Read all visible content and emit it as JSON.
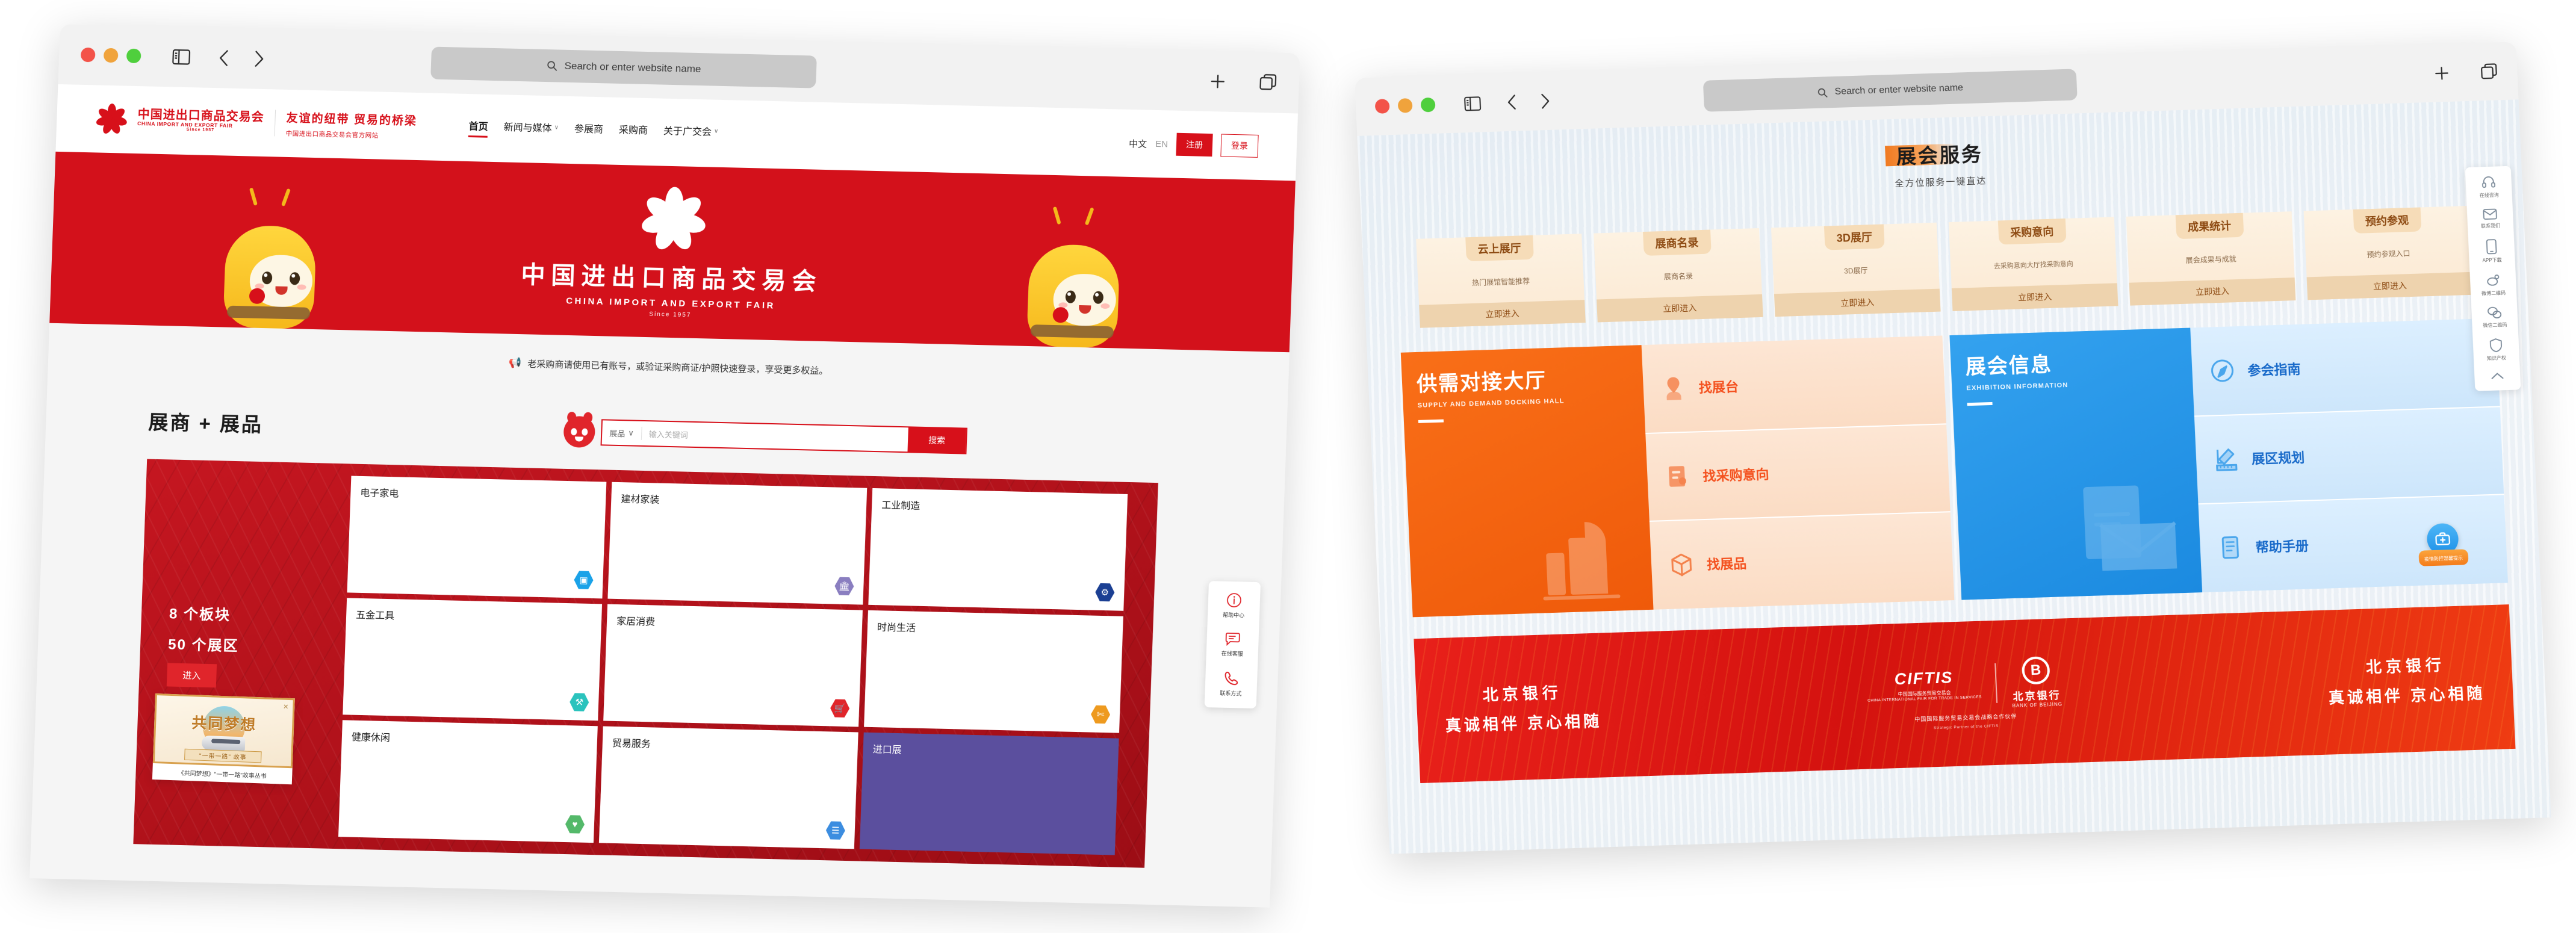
{
  "browser": {
    "search_placeholder": "Search or enter website name",
    "icons": {
      "sidebar": "sidebar-icon",
      "back": "back-chevron-icon",
      "forward": "forward-chevron-icon",
      "new_tab": "plus-icon",
      "tabs": "tab-overview-icon",
      "search": "search-icon"
    },
    "traffic_lights": [
      "close",
      "minimize",
      "zoom"
    ]
  },
  "left_window": {
    "nav": {
      "logo_cn": "中国进出口商品交易会",
      "logo_en": "CHINA IMPORT AND EXPORT FAIR",
      "logo_since": "Since 1957",
      "slogan_main": "友谊的纽带 贸易的桥梁",
      "slogan_sub": "中国进出口商品交易会官方网站",
      "menu": [
        {
          "label": "首页",
          "has_caret": false,
          "active": true
        },
        {
          "label": "新闻与媒体",
          "has_caret": true,
          "active": false
        },
        {
          "label": "参展商",
          "has_caret": false,
          "active": false
        },
        {
          "label": "采购商",
          "has_caret": false,
          "active": false
        },
        {
          "label": "关于广交会",
          "has_caret": true,
          "active": false
        }
      ],
      "lang_cn": "中文",
      "lang_en": "EN",
      "register": "注册",
      "login": "登录"
    },
    "hero": {
      "title_cn": "中国进出口商品交易会",
      "title_en": "CHINA IMPORT AND EXPORT FAIR",
      "since": "Since 1957",
      "bg_color": "#d3111b"
    },
    "notice": "老采购商请使用已有账号，或验证采购商证/护照快速登录，享受更多权益。",
    "section": {
      "title": "展商 + 展品",
      "search_select": "展品",
      "search_placeholder": "输入关键词",
      "search_button": "搜索"
    },
    "panel": {
      "line1": "8 个板块",
      "line2": "50 个展区",
      "enter_button": "进入"
    },
    "categories": [
      {
        "label": "电子家电",
        "icon": "chip-icon",
        "color": "#1aa2e8"
      },
      {
        "label": "建材家装",
        "icon": "building-icon",
        "color": "#8a7ec0"
      },
      {
        "label": "工业制造",
        "icon": "gear-icon",
        "color": "#1b3f93"
      },
      {
        "label": "五金工具",
        "icon": "tools-icon",
        "color": "#2bc3bd"
      },
      {
        "label": "家居消费",
        "icon": "cart-icon",
        "color": "#e0252b"
      },
      {
        "label": "时尚生活",
        "icon": "fashion-icon",
        "color": "#ee9a1f"
      },
      {
        "label": "健康休闲",
        "icon": "health-icon",
        "color": "#54b96a"
      },
      {
        "label": "贸易服务",
        "icon": "service-icon",
        "color": "#3c8de0"
      },
      {
        "label": "进口展",
        "icon": "import-icon",
        "color": "#5b4f9e"
      }
    ],
    "side_tools": [
      {
        "label": "帮助中心",
        "icon": "info-circle-icon"
      },
      {
        "label": "在线客服",
        "icon": "chat-bubble-icon"
      },
      {
        "label": "联系方式",
        "icon": "phone-icon"
      }
    ],
    "ad": {
      "title": "共同梦想",
      "scroll_text": "\"一带一路\" 故事",
      "caption": "《共同梦想》\"一带一路\"故事丛书",
      "close": "✕"
    }
  },
  "right_window": {
    "header": {
      "title": "展会服务",
      "subtitle": "全方位服务一键直达"
    },
    "service_cards": [
      {
        "title": "云上展厅",
        "desc": "热门展馆智能推荐",
        "button": "立即进入"
      },
      {
        "title": "展商名录",
        "desc": "展商名录",
        "button": "立即进入"
      },
      {
        "title": "3D展厅",
        "desc": "3D展厅",
        "button": "立即进入"
      },
      {
        "title": "采购意向",
        "desc": "去采购意向大厅找采购意向",
        "button": "立即进入"
      },
      {
        "title": "成果统计",
        "desc": "展会成果与成就",
        "button": "立即进入"
      },
      {
        "title": "预约参观",
        "desc": "预约参观入口",
        "button": "立即进入"
      }
    ],
    "blocks": [
      {
        "title_cn": "供需对接大厅",
        "title_en": "SUPPLY AND DEMAND DOCKING HALL",
        "theme": "orange",
        "color": "#f4511f",
        "links": [
          {
            "label": "找展台",
            "icon": "location-pin-person-icon"
          },
          {
            "label": "找采购意向",
            "icon": "document-person-icon"
          },
          {
            "label": "找展品",
            "icon": "package-box-icon"
          }
        ]
      },
      {
        "title_cn": "展会信息",
        "title_en": "EXHIBITION INFORMATION",
        "theme": "blue",
        "color": "#1769c9",
        "links": [
          {
            "label": "参会指南",
            "icon": "compass-icon"
          },
          {
            "label": "展区规划",
            "icon": "ruler-pencil-icon"
          },
          {
            "label": "帮助手册",
            "icon": "manual-book-icon"
          }
        ]
      }
    ],
    "bank_banner": {
      "left_line1": "北京银行",
      "left_line2": "真诚相伴 京心相随",
      "right_line1": "北京银行",
      "right_line2": "真诚相伴 京心相随",
      "ciftis_mark": "CIFTIS",
      "ciftis_cn": "中国国际服务贸易交易会",
      "ciftis_en": "CHINA INTERNATIONAL FAIR FOR TRADE IN SERVICES",
      "bob_mark": "B",
      "bob_cn": "北京银行",
      "bob_en": "BANK OF BEIJING",
      "footer_cn": "中国国际服务贸易交易会战略合作伙伴",
      "footer_en": "Strategic Partner of the CIFTIS"
    },
    "side_tools": [
      {
        "label": "在线咨询",
        "icon": "headset-icon"
      },
      {
        "label": "联系我们",
        "icon": "mail-icon"
      },
      {
        "label": "APP下载",
        "icon": "mobile-icon"
      },
      {
        "label": "微博二维码",
        "icon": "weibo-qr-icon"
      },
      {
        "label": "微信二维码",
        "icon": "wechat-qr-icon"
      },
      {
        "label": "知识产权",
        "icon": "shield-icon"
      },
      {
        "label": "返回顶部",
        "icon": "arrow-up-icon"
      }
    ],
    "floating_badge": {
      "label": "疫情防控温馨提示",
      "icon": "medical-kit-icon"
    }
  }
}
